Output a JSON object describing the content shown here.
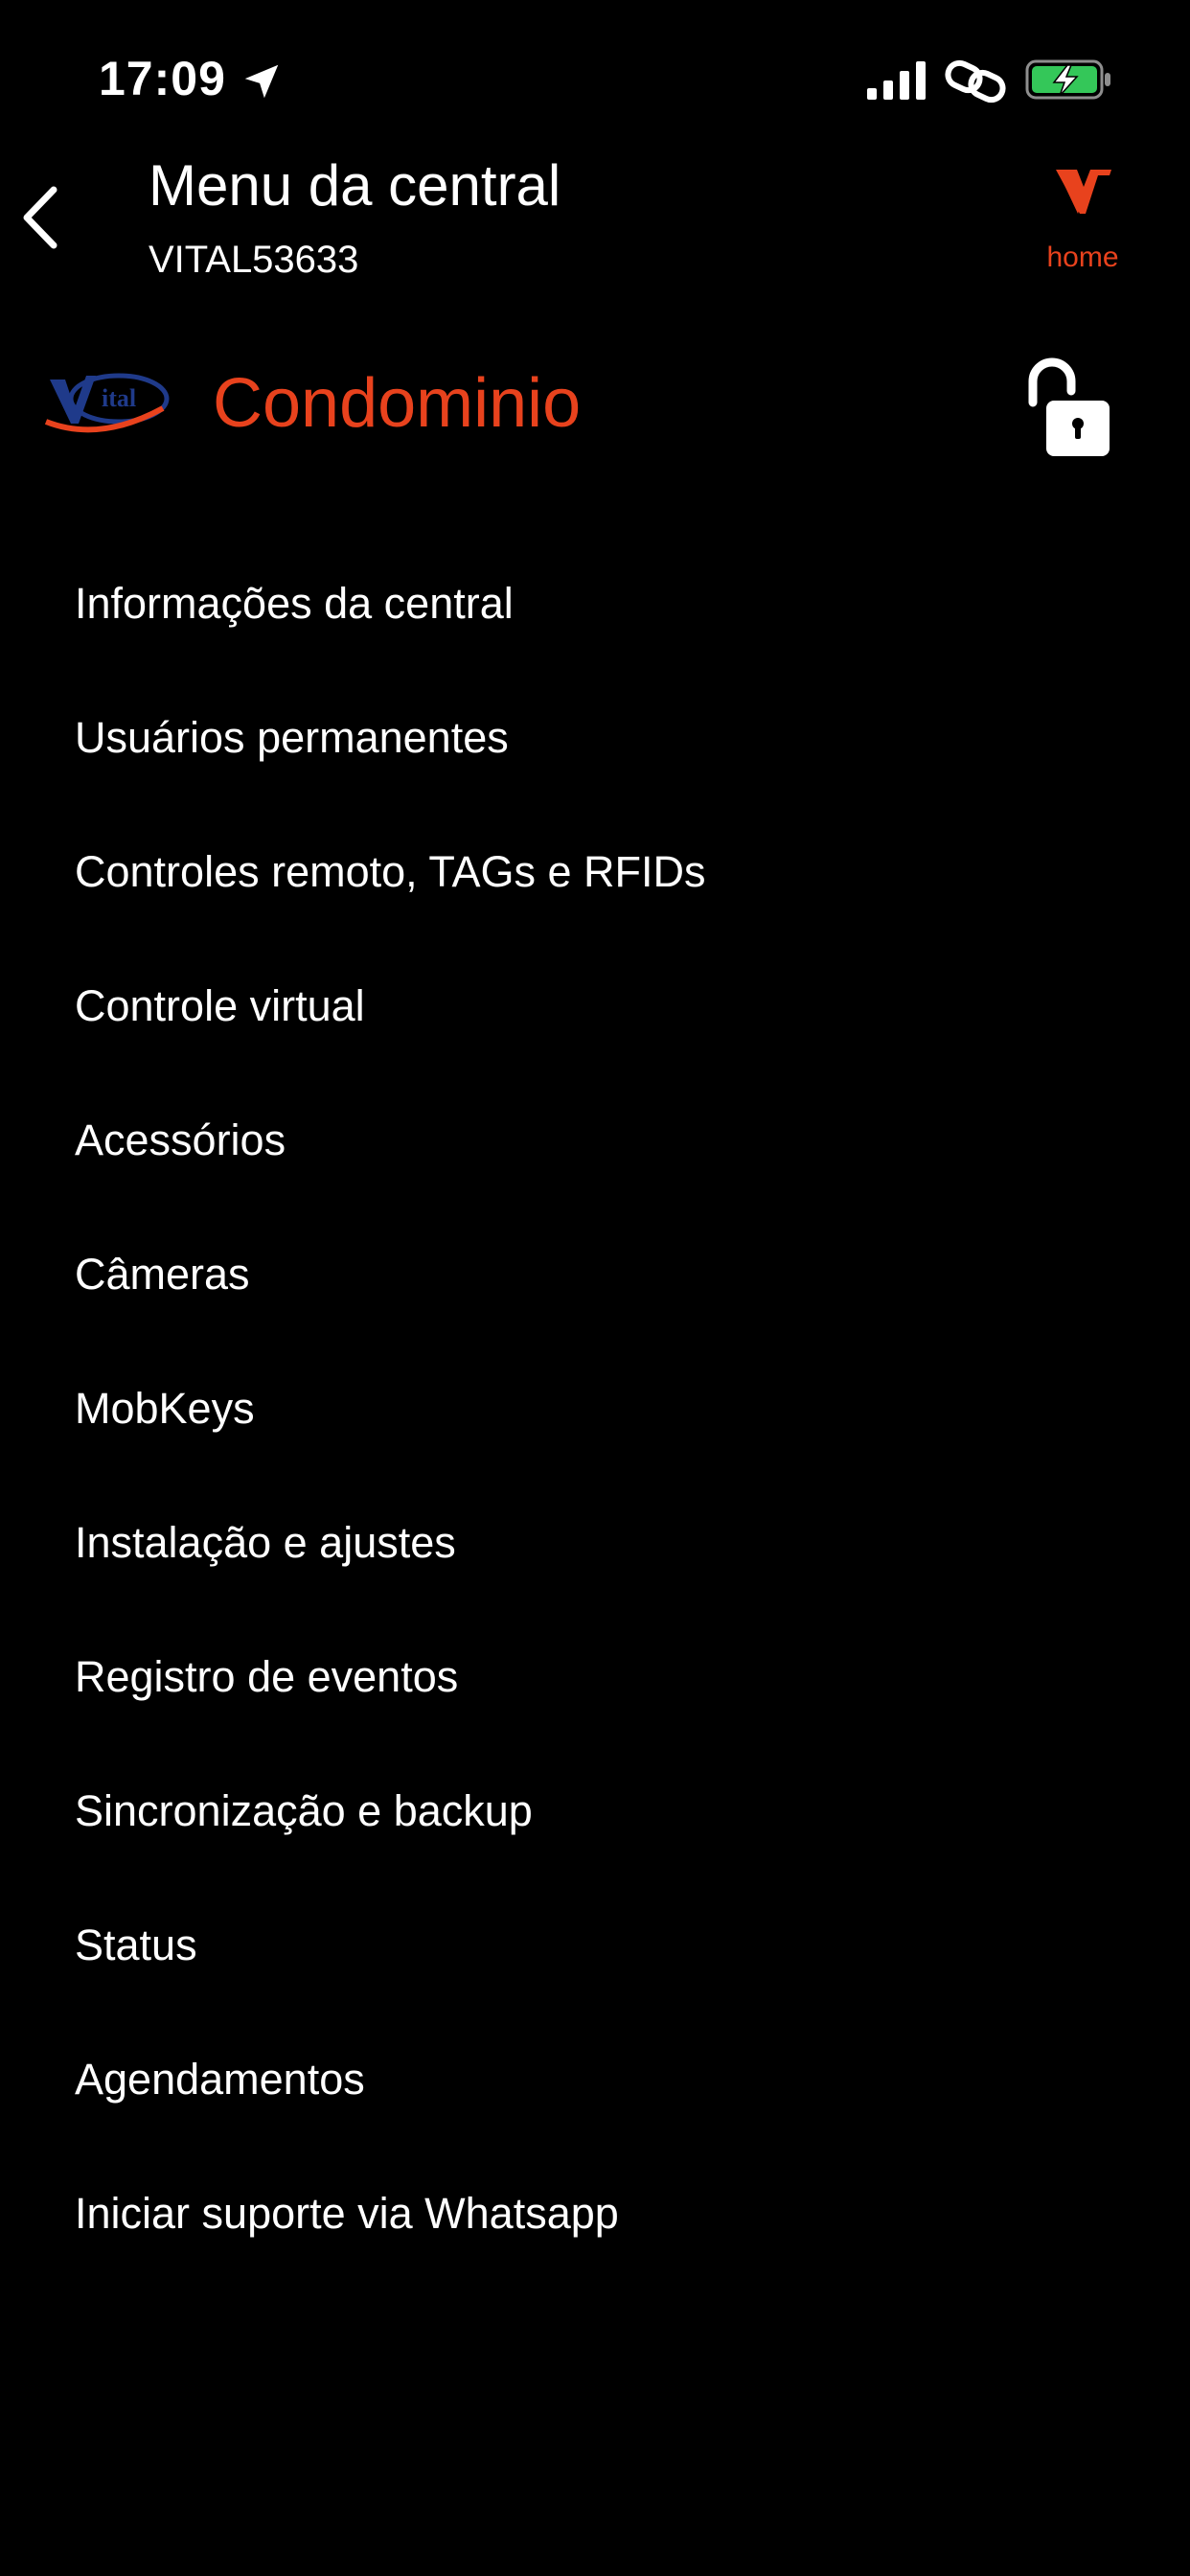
{
  "status_bar": {
    "time": "17:09",
    "icons": [
      "location-arrow-icon",
      "signal-bars-icon",
      "link-icon",
      "battery-charging-icon"
    ],
    "battery_color": "#34c759"
  },
  "nav": {
    "back_icon": "chevron-left-icon",
    "title": "Menu da central",
    "subtitle": "VITAL53633",
    "home_label": "home",
    "home_icon": "vital-v-logo-icon"
  },
  "site": {
    "logo_icon": "vital-brand-logo-icon",
    "name": "Condominio",
    "lock_icon": "unlocked-padlock-icon"
  },
  "colors": {
    "background": "#000000",
    "text": "#ffffff",
    "accent": "#e8421d",
    "logo_blue": "#1f3a8a"
  },
  "menu": {
    "items": [
      {
        "label": "Informações da central"
      },
      {
        "label": "Usuários permanentes"
      },
      {
        "label": "Controles remoto, TAGs e RFIDs"
      },
      {
        "label": "Controle virtual"
      },
      {
        "label": "Acessórios"
      },
      {
        "label": "Câmeras"
      },
      {
        "label": "MobKeys"
      },
      {
        "label": "Instalação e ajustes"
      },
      {
        "label": "Registro de eventos"
      },
      {
        "label": "Sincronização e backup"
      },
      {
        "label": "Status"
      },
      {
        "label": "Agendamentos"
      },
      {
        "label": "Iniciar suporte via Whatsapp"
      }
    ]
  }
}
